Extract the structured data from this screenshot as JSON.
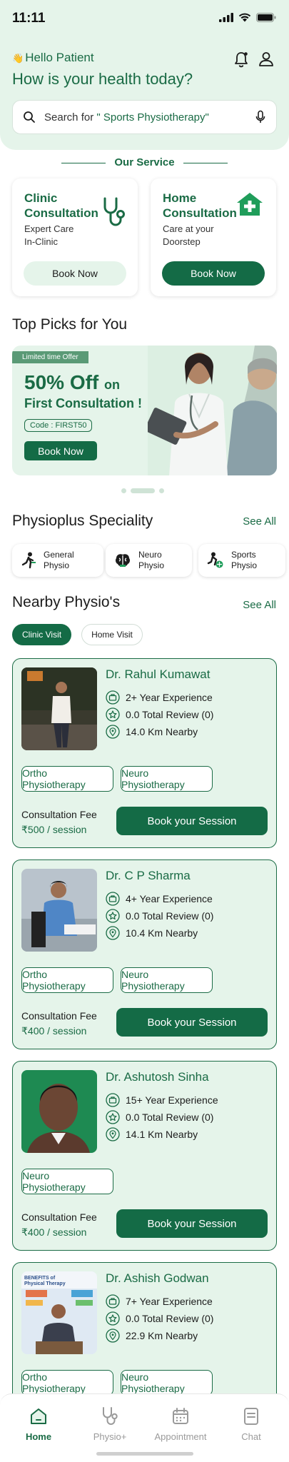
{
  "status": {
    "time": "11:11"
  },
  "header": {
    "greeting_emoji": "👋",
    "greeting": "Hello Patient",
    "headline": "How is your health today?"
  },
  "search": {
    "prefix": "Search for",
    "highlight": "\" Sports Physiotherapy\""
  },
  "services": {
    "title": "Our Service",
    "items": [
      {
        "line1": "Clinic",
        "line2": "Consultation",
        "desc1": "Expert Care",
        "desc2": "In-Clinic",
        "button": "Book Now",
        "icon": "stethoscope-icon"
      },
      {
        "line1": "Home",
        "line2": "Consultation",
        "desc1": "Care at your",
        "desc2": "Doorstep",
        "button": "Book Now",
        "icon": "home-plus-icon"
      }
    ]
  },
  "top_picks": {
    "title": "Top Picks for You",
    "banner": {
      "tag": "Limited time Offer",
      "big": "50% Off",
      "on": "on",
      "sub": "First Consultation !",
      "code": "Code : FIRST50",
      "button": "Book Now"
    }
  },
  "speciality": {
    "title": "Physioplus Speciality",
    "see_all": "See All",
    "items": [
      {
        "line1": "General",
        "line2": "Physio",
        "icon": "general-physio-icon"
      },
      {
        "line1": "Neuro",
        "line2": "Physio",
        "icon": "brain-icon"
      },
      {
        "line1": "Sports",
        "line2": "Physio",
        "icon": "sports-icon"
      }
    ]
  },
  "nearby": {
    "title": "Nearby Physio's",
    "see_all": "See All",
    "tabs": [
      "Clinic Visit",
      "Home Visit"
    ],
    "fee_label": "Consultation Fee",
    "book_label": "Book your Session",
    "doctors": [
      {
        "name": "Dr. Rahul Kumawat",
        "experience": "2+ Year Experience",
        "review": "0.0 Total Review (0)",
        "distance": "14.0 Km Nearby",
        "tags": [
          "Ortho Physiotherapy",
          "Neuro Physiotherapy"
        ],
        "fee": "₹500 / session"
      },
      {
        "name": "Dr. C P Sharma",
        "experience": "4+ Year Experience",
        "review": "0.0 Total Review (0)",
        "distance": "10.4 Km Nearby",
        "tags": [
          "Ortho Physiotherapy",
          "Neuro Physiotherapy"
        ],
        "fee": "₹400 / session"
      },
      {
        "name": "Dr. Ashutosh Sinha",
        "experience": "15+ Year Experience",
        "review": "0.0 Total Review (0)",
        "distance": "14.1 Km Nearby",
        "tags": [
          "Neuro Physiotherapy"
        ],
        "fee": "₹400 / session"
      },
      {
        "name": "Dr. Ashish Godwan",
        "experience": "7+ Year Experience",
        "review": "0.0 Total Review (0)",
        "distance": "22.9 Km Nearby",
        "tags": [
          "Ortho Physiotherapy",
          "Neuro Physiotherapy"
        ],
        "fee": ""
      },
      {
        "poster_title": "BENEFITS of Physical Therapy"
      }
    ]
  },
  "bottom_nav": {
    "items": [
      {
        "label": "Home",
        "icon": "home-icon",
        "active": true
      },
      {
        "label": "Physio+",
        "icon": "stethoscope-icon",
        "active": false
      },
      {
        "label": "Appointment",
        "icon": "calendar-icon",
        "active": false
      },
      {
        "label": "Chat",
        "icon": "chat-icon",
        "active": false
      }
    ]
  },
  "colors": {
    "primary": "#146b46",
    "primary_text": "#1a6b45",
    "tint": "#e5f4ea"
  }
}
